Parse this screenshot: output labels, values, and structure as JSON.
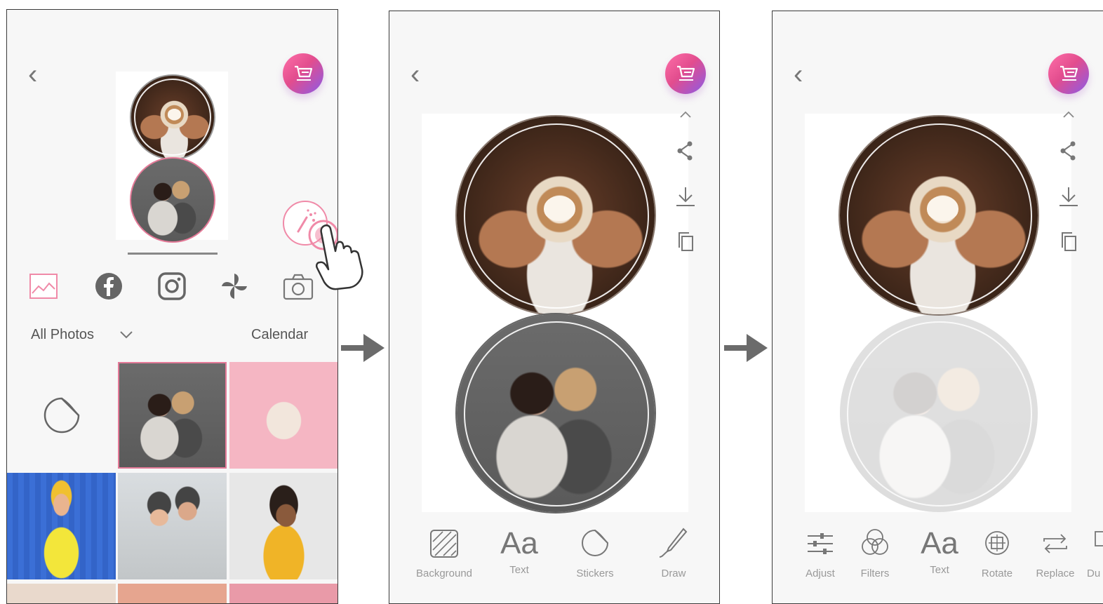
{
  "screen1": {
    "back_icon": "chevron-left",
    "cart_icon": "cart-icon",
    "sources": [
      {
        "name": "gallery-icon"
      },
      {
        "name": "facebook-icon"
      },
      {
        "name": "instagram-icon"
      },
      {
        "name": "pinwheel-icon"
      },
      {
        "name": "camera-icon"
      }
    ],
    "album_label": "All Photos",
    "calendar_label": "Calendar",
    "colors": {
      "accent": "#f08aa8",
      "pink_tile": "#f5b6c3"
    }
  },
  "screen2": {
    "tools": [
      {
        "label": "Background",
        "icon": "background-icon"
      },
      {
        "label": "Text",
        "icon_text": "Aa"
      },
      {
        "label": "Stickers",
        "icon": "sticker-icon"
      },
      {
        "label": "Draw",
        "icon": "draw-icon"
      }
    ]
  },
  "screen3": {
    "tools": [
      {
        "label": "Adjust",
        "icon": "adjust-icon"
      },
      {
        "label": "Filters",
        "icon": "filters-icon"
      },
      {
        "label": "Text",
        "icon_text": "Aa"
      },
      {
        "label": "Rotate",
        "icon": "rotate-icon"
      },
      {
        "label": "Replace",
        "icon": "replace-icon"
      },
      {
        "label": "Du",
        "icon": "duplicate-icon"
      }
    ]
  }
}
